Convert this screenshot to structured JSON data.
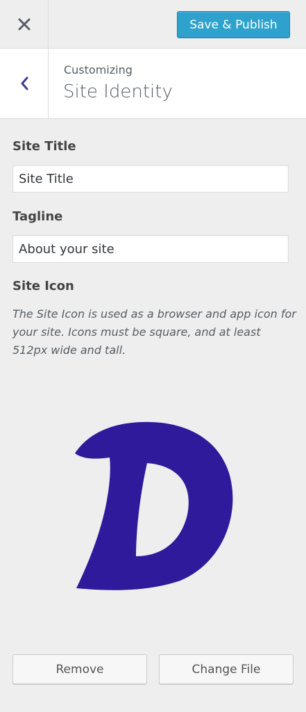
{
  "header": {
    "close_icon": "close-icon",
    "publish_label": "Save & Publish",
    "publish_color": "#2ea2cc"
  },
  "section": {
    "back_icon": "chevron-left-icon",
    "breadcrumb": "Customizing",
    "title": "Site Identity"
  },
  "fields": {
    "site_title": {
      "label": "Site Title",
      "value": "Site Title"
    },
    "tagline": {
      "label": "Tagline",
      "value": "About your site"
    }
  },
  "site_icon": {
    "label": "Site Icon",
    "description": "The Site Icon is used as a browser and app icon for your site. Icons must be square, and at least 512px wide and tall.",
    "icon_color": "#2e1a9b",
    "remove_label": "Remove",
    "change_label": "Change File"
  }
}
